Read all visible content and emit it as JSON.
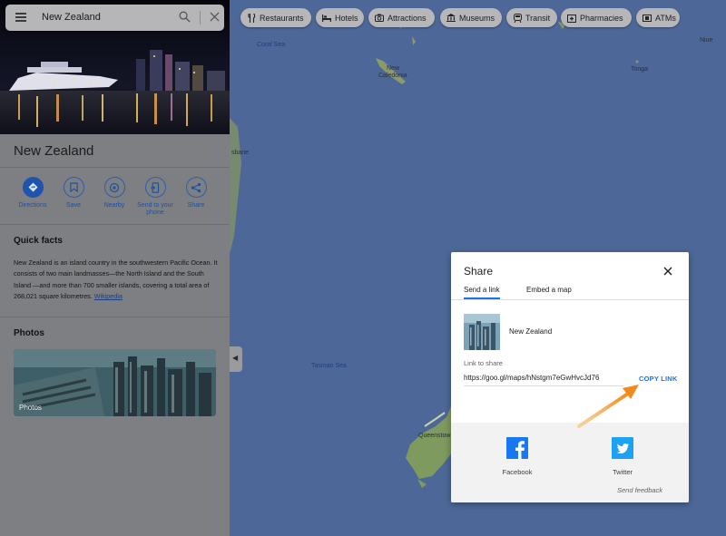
{
  "search": {
    "query": "New Zealand"
  },
  "place": {
    "title": "New Zealand"
  },
  "actions": [
    {
      "label": "Directions"
    },
    {
      "label": "Save"
    },
    {
      "label": "Nearby"
    },
    {
      "label": "Send to your phone"
    },
    {
      "label": "Share"
    }
  ],
  "quick_facts": {
    "title": "Quick facts",
    "text": "New Zealand is an island country in the southwestern Pacific Ocean. It consists of two main landmasses—the North Island and the South Island —and more than 700 smaller islands, covering a total area of 268,021 square kilometres.",
    "link": "Wikipedia"
  },
  "photos": {
    "title": "Photos",
    "card_label": "Photos"
  },
  "chips": [
    {
      "label": "Restaurants",
      "icon": "fork-knife-icon"
    },
    {
      "label": "Hotels",
      "icon": "bed-icon"
    },
    {
      "label": "Attractions",
      "icon": "camera-icon"
    },
    {
      "label": "Museums",
      "icon": "museum-icon"
    },
    {
      "label": "Transit",
      "icon": "train-icon"
    },
    {
      "label": "Pharmacies",
      "icon": "pharmacy-icon"
    },
    {
      "label": "ATMs",
      "icon": "atm-icon"
    }
  ],
  "map_labels": {
    "coral_sea": "Coral Sea",
    "new_caledonia_1": "New",
    "new_caledonia_2": "Caledonia",
    "tonga": "Tonga",
    "niue": "Niue",
    "tasman_sea": "Tasman Sea",
    "brisbane_frag": "sbane",
    "queenstown_frag": "Queenstow"
  },
  "dialog": {
    "title": "Share",
    "tabs": [
      "Send a link",
      "Embed a map"
    ],
    "place_name": "New Zealand",
    "link_label": "Link to share",
    "url": "https://goo.gl/maps/hNstgm7eGwHvcJd76",
    "copy_label": "COPY LINK",
    "social": [
      {
        "label": "Facebook",
        "color": "#1877f2"
      },
      {
        "label": "Twitter",
        "color": "#1da1f2"
      }
    ],
    "feedback": "Send feedback"
  },
  "colors": {
    "map_water": "#4d6898",
    "panel_dim": "#7e7f82",
    "accent": "#1a73e8",
    "arrow": "#f0a040"
  }
}
